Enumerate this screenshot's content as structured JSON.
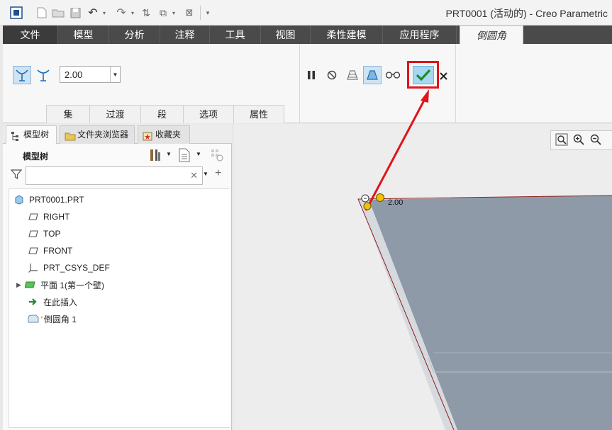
{
  "window": {
    "title": "PRT0001 (活动的) - Creo Parametric"
  },
  "quick_access": [
    {
      "name": "new-icon",
      "glyph": "▢"
    },
    {
      "name": "open-icon",
      "glyph": "▭"
    },
    {
      "name": "save-icon",
      "glyph": "▣"
    },
    {
      "name": "undo-icon",
      "glyph": "↶"
    },
    {
      "name": "redo-icon",
      "glyph": "↷"
    },
    {
      "name": "regenerate-icon",
      "glyph": "⇅"
    },
    {
      "name": "windows-icon",
      "glyph": "⧉"
    },
    {
      "name": "close-window-icon",
      "glyph": "⊠"
    },
    {
      "name": "customize-icon",
      "glyph": "▾"
    }
  ],
  "menu_tabs": [
    {
      "label": "文件"
    },
    {
      "label": "模型"
    },
    {
      "label": "分析"
    },
    {
      "label": "注释"
    },
    {
      "label": "工具"
    },
    {
      "label": "视图"
    },
    {
      "label": "柔性建模"
    },
    {
      "label": "应用程序"
    },
    {
      "label": "倒圆角"
    }
  ],
  "ribbon": {
    "radius_value": "2.00",
    "subtabs": [
      {
        "label": "集"
      },
      {
        "label": "过渡"
      },
      {
        "label": "段"
      },
      {
        "label": "选项"
      },
      {
        "label": "属性"
      }
    ]
  },
  "left_panel": {
    "tabs": [
      {
        "label": "模型树"
      },
      {
        "label": "文件夹浏览器"
      },
      {
        "label": "收藏夹"
      }
    ],
    "header": "模型树",
    "search_placeholder": "",
    "tree": [
      {
        "label": "PRT0001.PRT"
      },
      {
        "label": "RIGHT"
      },
      {
        "label": "TOP"
      },
      {
        "label": "FRONT"
      },
      {
        "label": "PRT_CSYS_DEF"
      },
      {
        "label": "平面 1(第一个壁)"
      },
      {
        "label": "在此插入"
      },
      {
        "label": "倒圆角 1"
      }
    ]
  },
  "graphics": {
    "dimension_label": "2.00"
  },
  "colors": {
    "accent_red": "#e0141a",
    "menu_dark": "#4a4a4a",
    "part_face": "#8e9aa8",
    "ok_button": "#a6d8f3"
  }
}
